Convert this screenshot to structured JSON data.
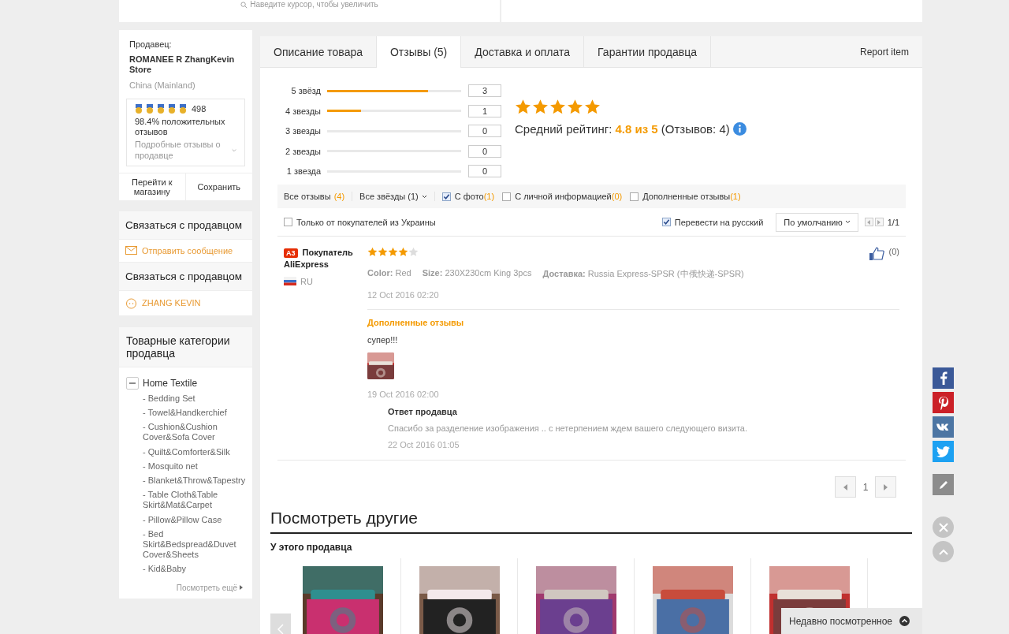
{
  "top": {
    "zoom_hint": "Наведите курсор, чтобы увеличить"
  },
  "seller": {
    "label": "Продавец:",
    "name": "ROMANEE R ZhangKevin Store",
    "country": "China (Mainland)",
    "score": "498",
    "positive": "98.4%",
    "positive_label": "положительных отзывов",
    "details": "Подробные отзывы о продавце",
    "buttons": [
      "Перейти к магазину",
      "Сохранить"
    ]
  },
  "contacts": [
    {
      "title": "Связаться с продавцом",
      "link": "Отправить сообщение",
      "kind": "message"
    },
    {
      "title": "Связаться с продавцом",
      "link": "ZHANG KEVIN",
      "kind": "person"
    }
  ],
  "categories": {
    "title": "Товарные категории продавца",
    "root": {
      "label": "Home Textile",
      "expanded": true,
      "children": [
        {
          "label": "- Bedding Set"
        },
        {
          "label": "- Towel&Handkerchief"
        },
        {
          "label": "- Cushion&Cushion Cover&Sofa Cover"
        },
        {
          "label": "- Quilt&Comforter&Silk"
        },
        {
          "label": "- Mosquito net"
        },
        {
          "label": "- Blanket&Throw&Tapestry"
        },
        {
          "label": "- Table Cloth&Table Skirt&Mat&Carpet"
        },
        {
          "label": "- Pillow&Pillow Case"
        },
        {
          "label": "- Bed Skirt&Bedspread&Duvet Cover&Sheets"
        },
        {
          "label": "- Kid&Baby"
        }
      ]
    },
    "more": "Посмотреть ещё"
  },
  "tabs": [
    {
      "label": "Описание товара",
      "selected": false
    },
    {
      "label": "Отзывы (5)",
      "selected": true
    },
    {
      "label": "Доставка и оплата",
      "selected": false
    },
    {
      "label": "Гарантии продавца",
      "selected": false
    }
  ],
  "report": "Report item",
  "rating_bars": [
    {
      "label": "5 звёзд",
      "level": 0.75,
      "count": "3"
    },
    {
      "label": "4 звезды",
      "level": 0.25,
      "count": "1"
    },
    {
      "label": "3 звезды",
      "level": 0,
      "count": "0"
    },
    {
      "label": "2 звезды",
      "level": 0,
      "count": "0"
    },
    {
      "label": "1 звезда",
      "level": 0,
      "count": "0"
    }
  ],
  "summary": {
    "stars": 5,
    "label": "Средний рейтинг:",
    "value": "4.8 из 5",
    "count": "(Отзывов: 4)"
  },
  "filters": [
    {
      "kind": "link",
      "label": "Все отзывы",
      "count": "(4)"
    },
    {
      "kind": "dropdown",
      "label": "Все звёзды (1)"
    },
    {
      "kind": "checkbox",
      "checked": true,
      "label": "С фото",
      "count": "(1)"
    },
    {
      "kind": "checkbox",
      "checked": false,
      "label": "С личной информацией",
      "count": "(0)"
    },
    {
      "kind": "checkbox",
      "checked": false,
      "label": "Дополненные отзывы",
      "count": "(1)"
    }
  ],
  "options": {
    "local_only": {
      "label": "Только от покупателей из Украины",
      "checked": false
    },
    "translate": {
      "label": "Перевести на русский",
      "checked": true
    },
    "sort": "По умолчанию",
    "pages": "1/1"
  },
  "review": {
    "badge": "A3",
    "name": "Покупатель AliExpress",
    "country": "RU",
    "stars": 4,
    "likes": "(0)",
    "attributes": [
      {
        "label": "Color:",
        "value": "Red"
      },
      {
        "label": "Size:",
        "value": "230X230cm King 3pcs"
      },
      {
        "label": "Доставка:",
        "value": "Russia Express-SPSR (中俄快递-SPSR)"
      }
    ],
    "date": "12 Oct 2016 02:20",
    "additional": {
      "title": "Дополненные отзывы",
      "text": "супер!!!",
      "date": "19 Oct 2016 02:00"
    },
    "reply": {
      "title": "Ответ продавца",
      "text": "Спасибо за разделение изображения .. с нетерпением ждем вашего следующего визита.",
      "date": "22 Oct 2016 01:05"
    }
  },
  "pagination": {
    "page": "1"
  },
  "more": {
    "title": "Посмотреть другие",
    "subtitle": "У этого продавца"
  },
  "recent": "Недавно посмотренное"
}
